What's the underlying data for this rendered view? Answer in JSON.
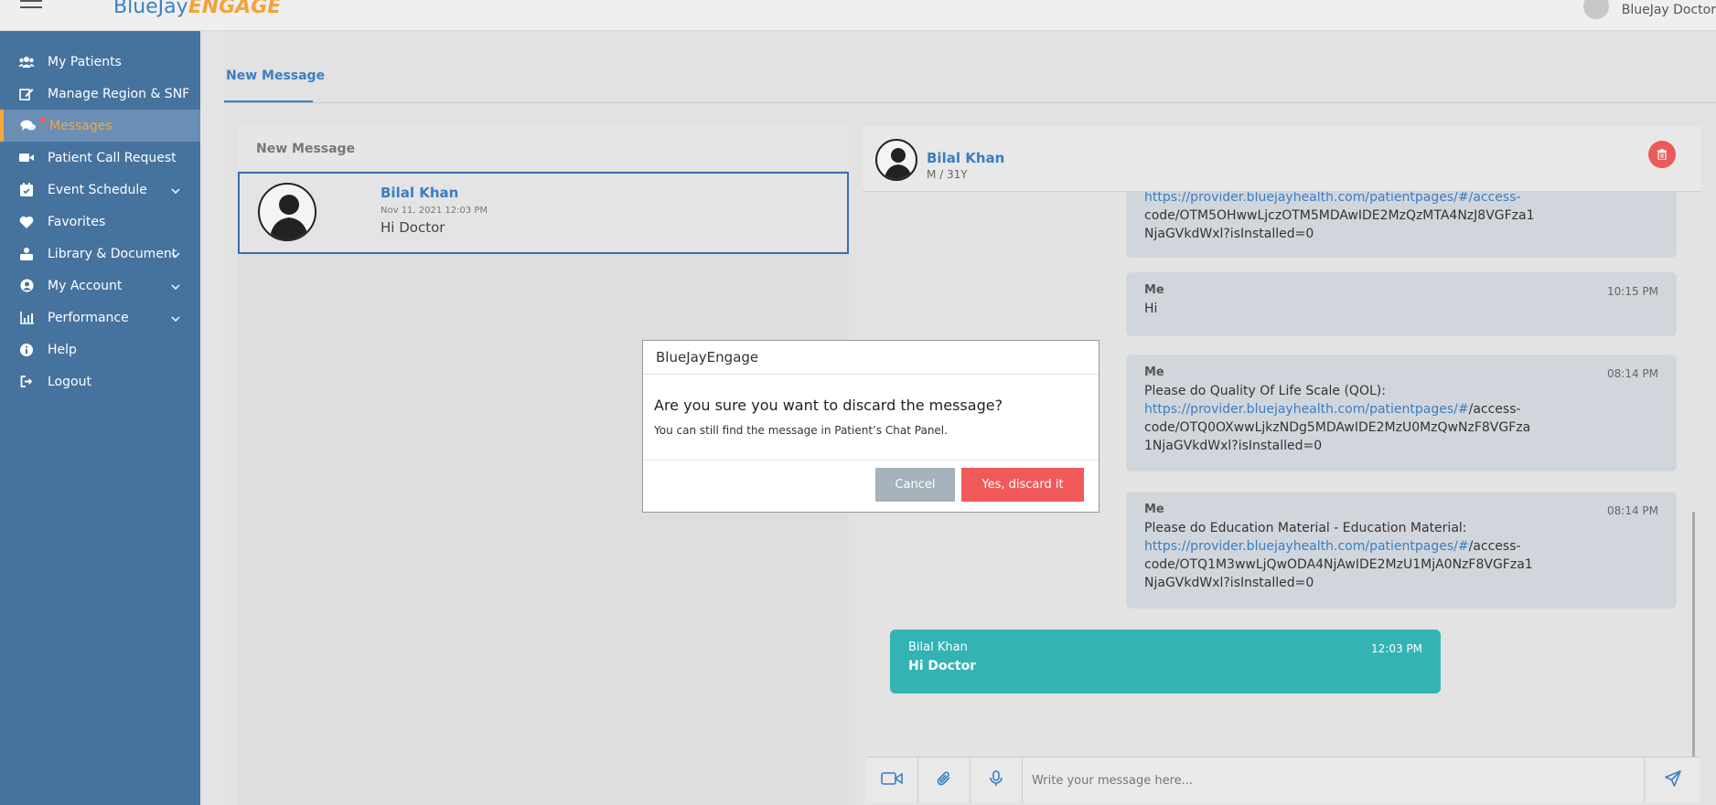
{
  "header": {
    "logo_part1": "BlueJay",
    "logo_part2": "ENGAGE",
    "user_name": "BlueJay Doctor"
  },
  "sidebar": {
    "items": [
      {
        "label": "My Patients",
        "icon": "users-icon"
      },
      {
        "label": "Manage Region & SNF",
        "icon": "edit-icon"
      },
      {
        "label": "Messages",
        "icon": "chat-icon",
        "active": true
      },
      {
        "label": "Patient Call Request",
        "icon": "video-icon"
      },
      {
        "label": "Event Schedule",
        "icon": "calendar-icon",
        "expandable": true
      },
      {
        "label": "Favorites",
        "icon": "heart-icon"
      },
      {
        "label": "Library & Document",
        "icon": "library-icon",
        "expandable": true
      },
      {
        "label": "My Account",
        "icon": "account-icon",
        "expandable": true
      },
      {
        "label": "Performance",
        "icon": "chart-icon",
        "expandable": true
      },
      {
        "label": "Help",
        "icon": "info-icon"
      },
      {
        "label": "Logout",
        "icon": "logout-icon"
      }
    ]
  },
  "main": {
    "tab_label": "New Message",
    "list_header": "New Message",
    "conversation": {
      "name": "Bilal Khan",
      "date": "Nov 11, 2021 12:03 PM",
      "preview": "Hi Doctor"
    }
  },
  "chat": {
    "patient_name": "Bilal Khan",
    "patient_meta": "M / 31Y",
    "messages": [
      {
        "sender": "",
        "time": "",
        "line1": "https://provider.bluejayhealth.com/patientpages/#/access-",
        "line2": "code/OTM5OHwwLjczOTM5MDAwIDE2MzQzMTA4NzJ8VGFza1",
        "line3": "NjaGVkdWxl?isInstalled=0"
      },
      {
        "sender": "Me",
        "time": "10:15 PM",
        "text": "Hi"
      },
      {
        "sender": "Me",
        "time": "08:14 PM",
        "text": "Please do Quality Of Life Scale (QOL):",
        "link": "https://provider.bluejayhealth.com/patientpages/#",
        "link_rest": "/access-",
        "line2": "code/OTQ0OXwwLjkzNDg5MDAwIDE2MzU0MzQwNzF8VGFza",
        "line3": "1NjaGVkdWxl?isInstalled=0"
      },
      {
        "sender": "Me",
        "time": "08:14 PM",
        "text": "Please do Education Material - Education Material:",
        "link": "https://provider.bluejayhealth.com/patientpages/#",
        "link_rest": "/access-",
        "line2": "code/OTQ1M3wwLjQwODA4NjAwIDE2MzU1MjA0NzF8VGFza1",
        "line3": "NjaGVkdWxl?isInstalled=0"
      },
      {
        "sender": "Bilal Khan",
        "time": "12:03 PM",
        "text": "Hi Doctor"
      }
    ],
    "composer_placeholder": "Write your message here..."
  },
  "modal": {
    "title": "BlueJayEngage",
    "question": "Are you sure you want to discard the message?",
    "subtext": "You can still find the message in Patient’s Chat Panel.",
    "cancel_label": "Cancel",
    "confirm_label": "Yes, discard it"
  },
  "colors": {
    "sidebar_bg": "#46729e",
    "accent_orange": "#f6a73c",
    "link_blue": "#3a7ec2",
    "patient_bubble": "#34b3b4",
    "danger": "#f05a5a"
  }
}
